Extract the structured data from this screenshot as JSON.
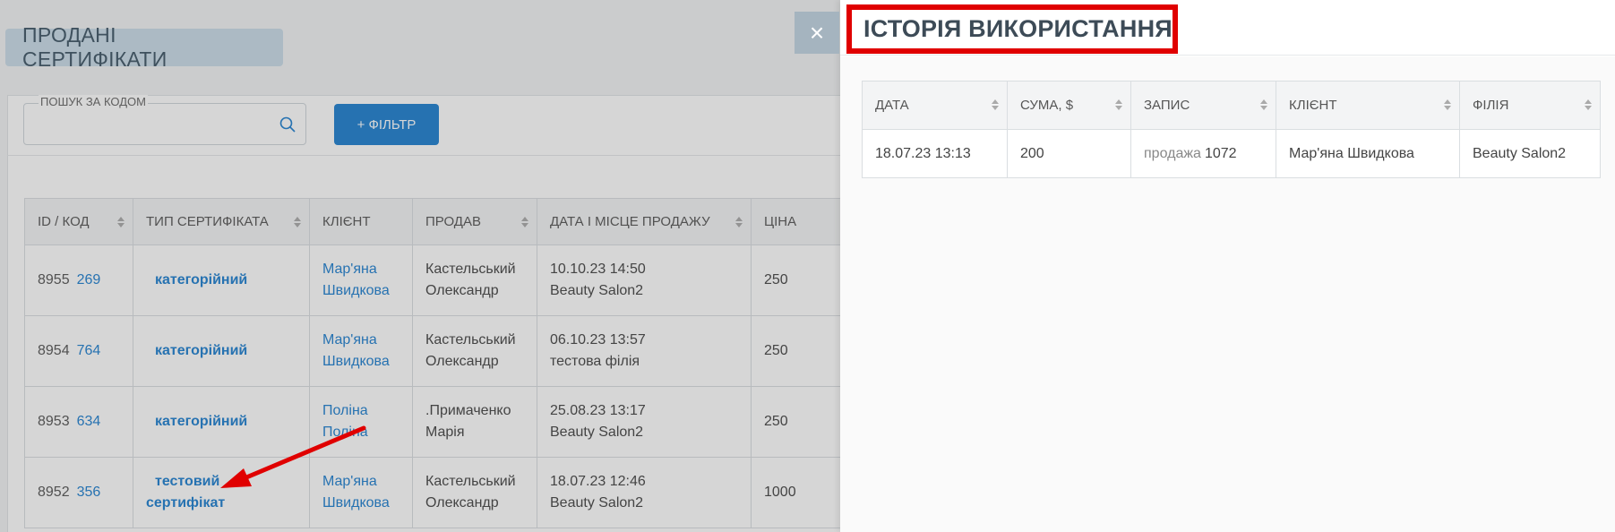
{
  "page": {
    "title": "ПРОДАНІ СЕРТИФІКАТИ",
    "search": {
      "label": "ПОШУК ЗА КОДОМ",
      "value": "",
      "placeholder": ""
    },
    "filter_button": "+ ФІЛЬТР"
  },
  "table": {
    "columns": [
      "ID / КОД",
      "ТИП СЕРТИФІКАТА",
      "КЛІЄНТ",
      "ПРОДАВ",
      "ДАТА І МІСЦЕ ПРОДАЖУ",
      "ЦІНА"
    ],
    "rows": [
      {
        "id": "8955",
        "code": "269",
        "type_line1": "категорійний",
        "type_line2": "",
        "client_line1": "Мар'яна",
        "client_line2": "Швидкова",
        "seller_line1": "Кастельський",
        "seller_line2": "Олександр",
        "date": "10.10.23 14:50",
        "place": "Beauty Salon2",
        "price": "250"
      },
      {
        "id": "8954",
        "code": "764",
        "type_line1": "категорійний",
        "type_line2": "",
        "client_line1": "Мар'яна",
        "client_line2": "Швидкова",
        "seller_line1": "Кастельський",
        "seller_line2": "Олександр",
        "date": "06.10.23 13:57",
        "place": "тестова філія",
        "price": "250"
      },
      {
        "id": "8953",
        "code": "634",
        "type_line1": "категорійний",
        "type_line2": "",
        "client_line1": "Поліна",
        "client_line2": "Поліна",
        "seller_line1": ".Примаченко",
        "seller_line2": "Марія",
        "date": "25.08.23 13:17",
        "place": "Beauty Salon2",
        "price": "250"
      },
      {
        "id": "8952",
        "code": "356",
        "type_line1": "тестовий",
        "type_line2": "сертифікат",
        "client_line1": "Мар'яна",
        "client_line2": "Швидкова",
        "seller_line1": "Кастельський",
        "seller_line2": "Олександр",
        "date": "18.07.23 12:46",
        "place": "Beauty Salon2",
        "price": "1000"
      }
    ]
  },
  "modal": {
    "close_symbol": "×",
    "title": "ІСТОРІЯ ВИКОРИСТАННЯ",
    "columns": [
      "ДАТА",
      "СУМА, $",
      "ЗАПИС",
      "КЛІЄНТ",
      "ФІЛІЯ"
    ],
    "rows": [
      {
        "date": "18.07.23 13:13",
        "amount": "200",
        "record_word": "продажа",
        "record_num": "1072",
        "client": "Мар'яна Швидкова",
        "branch": "Beauty Salon2"
      }
    ]
  },
  "colors": {
    "accent_blue": "#1e7fd0",
    "amount_green": "#2eb82e",
    "highlight_red": "#e00000",
    "arrow_red": "#e00000"
  },
  "icons": {
    "search": "search-icon",
    "sort": "sort-arrows-icon",
    "close": "close-icon",
    "annotation": "red-arrow-annotation"
  }
}
